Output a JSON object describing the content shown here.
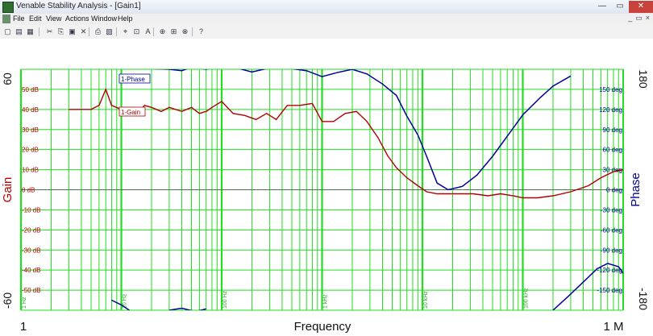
{
  "window": {
    "title": "Venable Stability Analysis - [Gain1]",
    "controls": {
      "minimize": "—",
      "maximize": "▭",
      "close": "✕"
    }
  },
  "menu": {
    "items": [
      "File",
      "Edit",
      "View",
      "Actions",
      "Window",
      "Help"
    ],
    "mdi_controls": [
      "_",
      "▭",
      "×"
    ]
  },
  "toolbar": {
    "buttons": [
      "new-icon",
      "open-icon",
      "save-icon",
      "cut-icon",
      "copy-icon",
      "paste-icon",
      "delete-icon",
      "print-icon",
      "print-preview-icon",
      "cursor-icon",
      "zoom-box-icon",
      "text-icon",
      "measure-icon",
      "settings-icon",
      "dsp-icon",
      "help-icon"
    ],
    "glyphs": [
      "▢",
      "▤",
      "▦",
      "✂",
      "⎘",
      "▣",
      "✕",
      "⎙",
      "▧",
      "⌖",
      "⊡",
      "A",
      "⊕",
      "⊞",
      "⊗",
      "?"
    ]
  },
  "chart_data": {
    "type": "line",
    "xlabel": "Frequency",
    "x_scale": "log",
    "xlim": [
      1,
      1000000
    ],
    "x_end_labels": [
      "1",
      "1 M"
    ],
    "decade_labels": [
      "1 Hz",
      "10 Hz",
      "100 Hz",
      "1 kHz",
      "10 kHz",
      "100 kHz"
    ],
    "left_axis": {
      "label": "Gain",
      "color": "#c00000",
      "limits": [
        -60,
        60
      ],
      "limit_labels": [
        "-60",
        "60"
      ],
      "ticks": [
        50,
        40,
        30,
        20,
        10,
        0,
        -10,
        -20,
        -30,
        -40,
        -50
      ],
      "tick_labels": [
        "50 dB",
        "40 dB",
        "30 dB",
        "20 dB",
        "10 dB",
        "0 dB",
        "-10 dB",
        "-20 dB",
        "-30 dB",
        "-40 dB",
        "-50 dB"
      ]
    },
    "right_axis": {
      "label": "Phase",
      "color": "#000099",
      "limits": [
        -180,
        180
      ],
      "limit_labels": [
        "-180",
        "180"
      ],
      "ticks": [
        150,
        120,
        90,
        60,
        30,
        0,
        -30,
        -60,
        -90,
        -120,
        -150
      ],
      "tick_labels": [
        "150 deg",
        "120 deg",
        "90 deg",
        "60 deg",
        "30 deg",
        "0 deg",
        "-30 deg",
        "-60 deg",
        "-90 deg",
        "-120 deg",
        "-150 deg"
      ]
    },
    "grid": true,
    "grid_color": "#22dd22",
    "series": [
      {
        "name": "1-Gain",
        "axis": "left",
        "color": "#b00000",
        "x": [
          3,
          5,
          6,
          7,
          8,
          10,
          12,
          14,
          17,
          20,
          25,
          30,
          40,
          50,
          60,
          70,
          80,
          100,
          130,
          170,
          220,
          280,
          350,
          450,
          600,
          800,
          1000,
          1300,
          1700,
          2200,
          2800,
          3600,
          4500,
          5500,
          7000,
          9000,
          11000,
          14000,
          18000,
          24000,
          32000,
          45000,
          60000,
          80000,
          100000,
          140000,
          200000,
          300000,
          450000,
          600000,
          800000,
          1000000
        ],
        "y": [
          40,
          40,
          42,
          50,
          42,
          40,
          38,
          37,
          42,
          41,
          39,
          41,
          39,
          41,
          38,
          39,
          41,
          44,
          38,
          37,
          35,
          38,
          35,
          42,
          42,
          43,
          34,
          34,
          38,
          39,
          34,
          26,
          17,
          11,
          6,
          2,
          -1,
          -2,
          -2,
          -2,
          -2,
          -3,
          -2,
          -3,
          -4,
          -4,
          -3,
          -1,
          2,
          6,
          9,
          10
        ]
      },
      {
        "name": "1-Phase",
        "axis": "right",
        "color": "#000099",
        "x_top": [
          12,
          20,
          30,
          40,
          50,
          70,
          100,
          150,
          200,
          300,
          400,
          500,
          700,
          1000,
          1400,
          2000,
          2800,
          4000,
          5500,
          7000,
          9000,
          11000,
          14000,
          18000,
          25000,
          35000,
          50000,
          70000,
          100000,
          150000,
          200000,
          300000
        ],
        "y_top": [
          183,
          181,
          180,
          178,
          183,
          180,
          187,
          181,
          176,
          182,
          186,
          181,
          178,
          169,
          175,
          180,
          173,
          158,
          141,
          110,
          82,
          50,
          10,
          0,
          5,
          22,
          50,
          80,
          112,
          138,
          155,
          170
        ],
        "x_bot": [
          8,
          10,
          12
        ],
        "y_bot": [
          -165,
          -172,
          -180
        ],
        "x_bot2": [
          30,
          40,
          55,
          70
        ],
        "y_bot2": [
          -180,
          -177,
          -182,
          -178
        ],
        "x_bot3": [
          200000,
          280000,
          400000,
          550000,
          700000,
          900000,
          1000000
        ],
        "y_bot3": [
          -180,
          -160,
          -138,
          -118,
          -110,
          -115,
          -125
        ]
      }
    ]
  }
}
